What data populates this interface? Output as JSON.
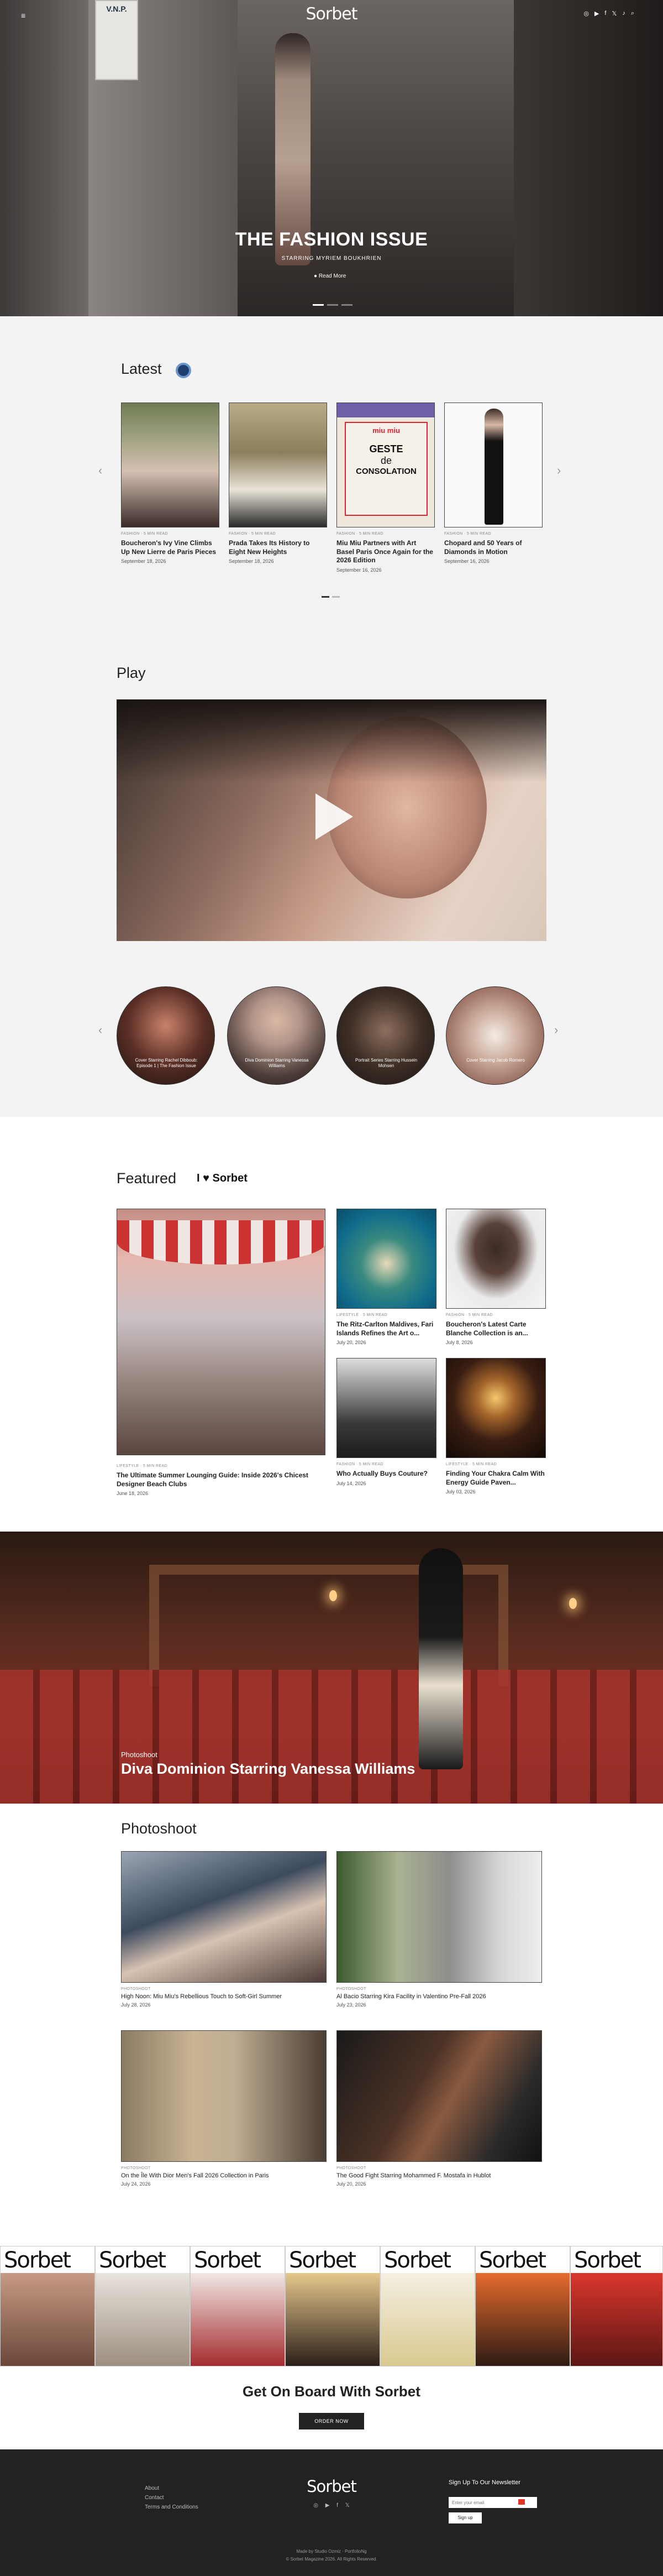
{
  "header": {
    "logo": "Sorbet",
    "menu_glyph": "≡",
    "social_icons": [
      "instagram-icon",
      "youtube-icon",
      "facebook-icon",
      "x-icon",
      "tiktok-icon",
      "search-icon"
    ],
    "social_glyphs": [
      "◎",
      "▶",
      "f",
      "𝕏",
      "♪",
      "⌕"
    ]
  },
  "hero": {
    "sign_text": "V.N.P.",
    "title": "THE FASHION ISSUE",
    "subtitle": "STARRING MYRIEM BOUKHRIEN",
    "read_more": "● Read More",
    "slides": 3
  },
  "latest": {
    "heading": "Latest",
    "cards": [
      {
        "category": "FASHION · 5 MIN READ",
        "title": "Boucheron's Ivy Vine Climbs Up New Lierre de Paris Pieces",
        "date": "September 18, 2026"
      },
      {
        "category": "FASHION · 5 MIN READ",
        "title": "Prada Takes Its History to Eight New Heights",
        "date": "September 18, 2026"
      },
      {
        "category": "FASHION · 5 MIN READ",
        "title": "Miu Miu Partners with Art Basel Paris Once Again for the 2026 Edition",
        "date": "September 16, 2026"
      },
      {
        "category": "FASHION · 5 MIN READ",
        "title": "Chopard and 50 Years of Diamonds in Motion",
        "date": "September 16, 2026"
      }
    ],
    "poster": {
      "brand": "miu miu",
      "line1": "GESTE",
      "line2": "de",
      "line3": "CONSOLATION"
    }
  },
  "play": {
    "heading": "Play",
    "videos": [
      {
        "caption": "Cover Starring Rachel Dibboub: Episode 1 | The Fashion Issue"
      },
      {
        "caption": "Diva Dominion Starring Vanessa Williams"
      },
      {
        "caption": "Portrait Series Starring Hussein Mohsen"
      },
      {
        "caption": "Cover Starring Jacob Romero"
      }
    ]
  },
  "featured": {
    "heading": "Featured",
    "sticker": "I ♥ Sorbet",
    "big": {
      "category": "LIFESTYLE · 5 MIN READ",
      "title": "The Ultimate Summer Lounging Guide: Inside 2026's Chicest Designer Beach Clubs",
      "date": "June 18, 2026"
    },
    "small": [
      {
        "category": "LIFESTYLE · 5 MIN READ",
        "title": "The Ritz-Carlton Maldives, Fari Islands Refines the Art o...",
        "date": "July 20, 2026"
      },
      {
        "category": "FASHION · 5 MIN READ",
        "title": "Boucheron's Latest Carte Blanche Collection is an...",
        "date": "July 8, 2026"
      },
      {
        "category": "FASHION · 5 MIN READ",
        "title": "Who Actually Buys Couture?",
        "date": "July 14, 2026"
      },
      {
        "category": "LIFESTYLE · 5 MIN READ",
        "title": "Finding Your Chakra Calm With Energy Guide Paven...",
        "date": "July 03, 2026"
      }
    ]
  },
  "banner": {
    "kicker": "Photoshoot",
    "title": "Diva Dominion Starring Vanessa Williams"
  },
  "photoshoot": {
    "heading": "Photoshoot",
    "cards": [
      {
        "category": "PHOTOSHOOT",
        "title": "High Noon: Miu Miu's Rebellious Touch to Soft-Girl Summer",
        "date": "July 28, 2026"
      },
      {
        "category": "PHOTOSHOOT",
        "title": "Al Bacio Starring Kira Facility in Valentino Pre-Fall 2026",
        "date": "July 23, 2026"
      },
      {
        "category": "PHOTOSHOOT",
        "title": "On the Île With Dior Men's Fall 2026 Collection in Paris",
        "date": "July 24, 2026"
      },
      {
        "category": "PHOTOSHOOT",
        "title": "The Good Fight Starring Mohammed F. Mostafa in Hublot",
        "date": "July 20, 2026"
      }
    ]
  },
  "covers": {
    "mast": "Sorbet",
    "count": 7
  },
  "cta": {
    "title": "Get On Board With Sorbet",
    "button": "ORDER NOW"
  },
  "footer": {
    "links": [
      "About",
      "Contact",
      "Terms and Conditions"
    ],
    "logo": "Sorbet",
    "icons": "◎ ▶ f 𝕏",
    "newsletter_title": "Sign Up To Our Newsletter",
    "email_placeholder": "Enter your email",
    "subscribe": "Sign up",
    "made_by": "Made by Studio Ozmiz · PortfolioNg",
    "copyright": "© Sorbet Magazine 2026. All Rights Reserved."
  }
}
